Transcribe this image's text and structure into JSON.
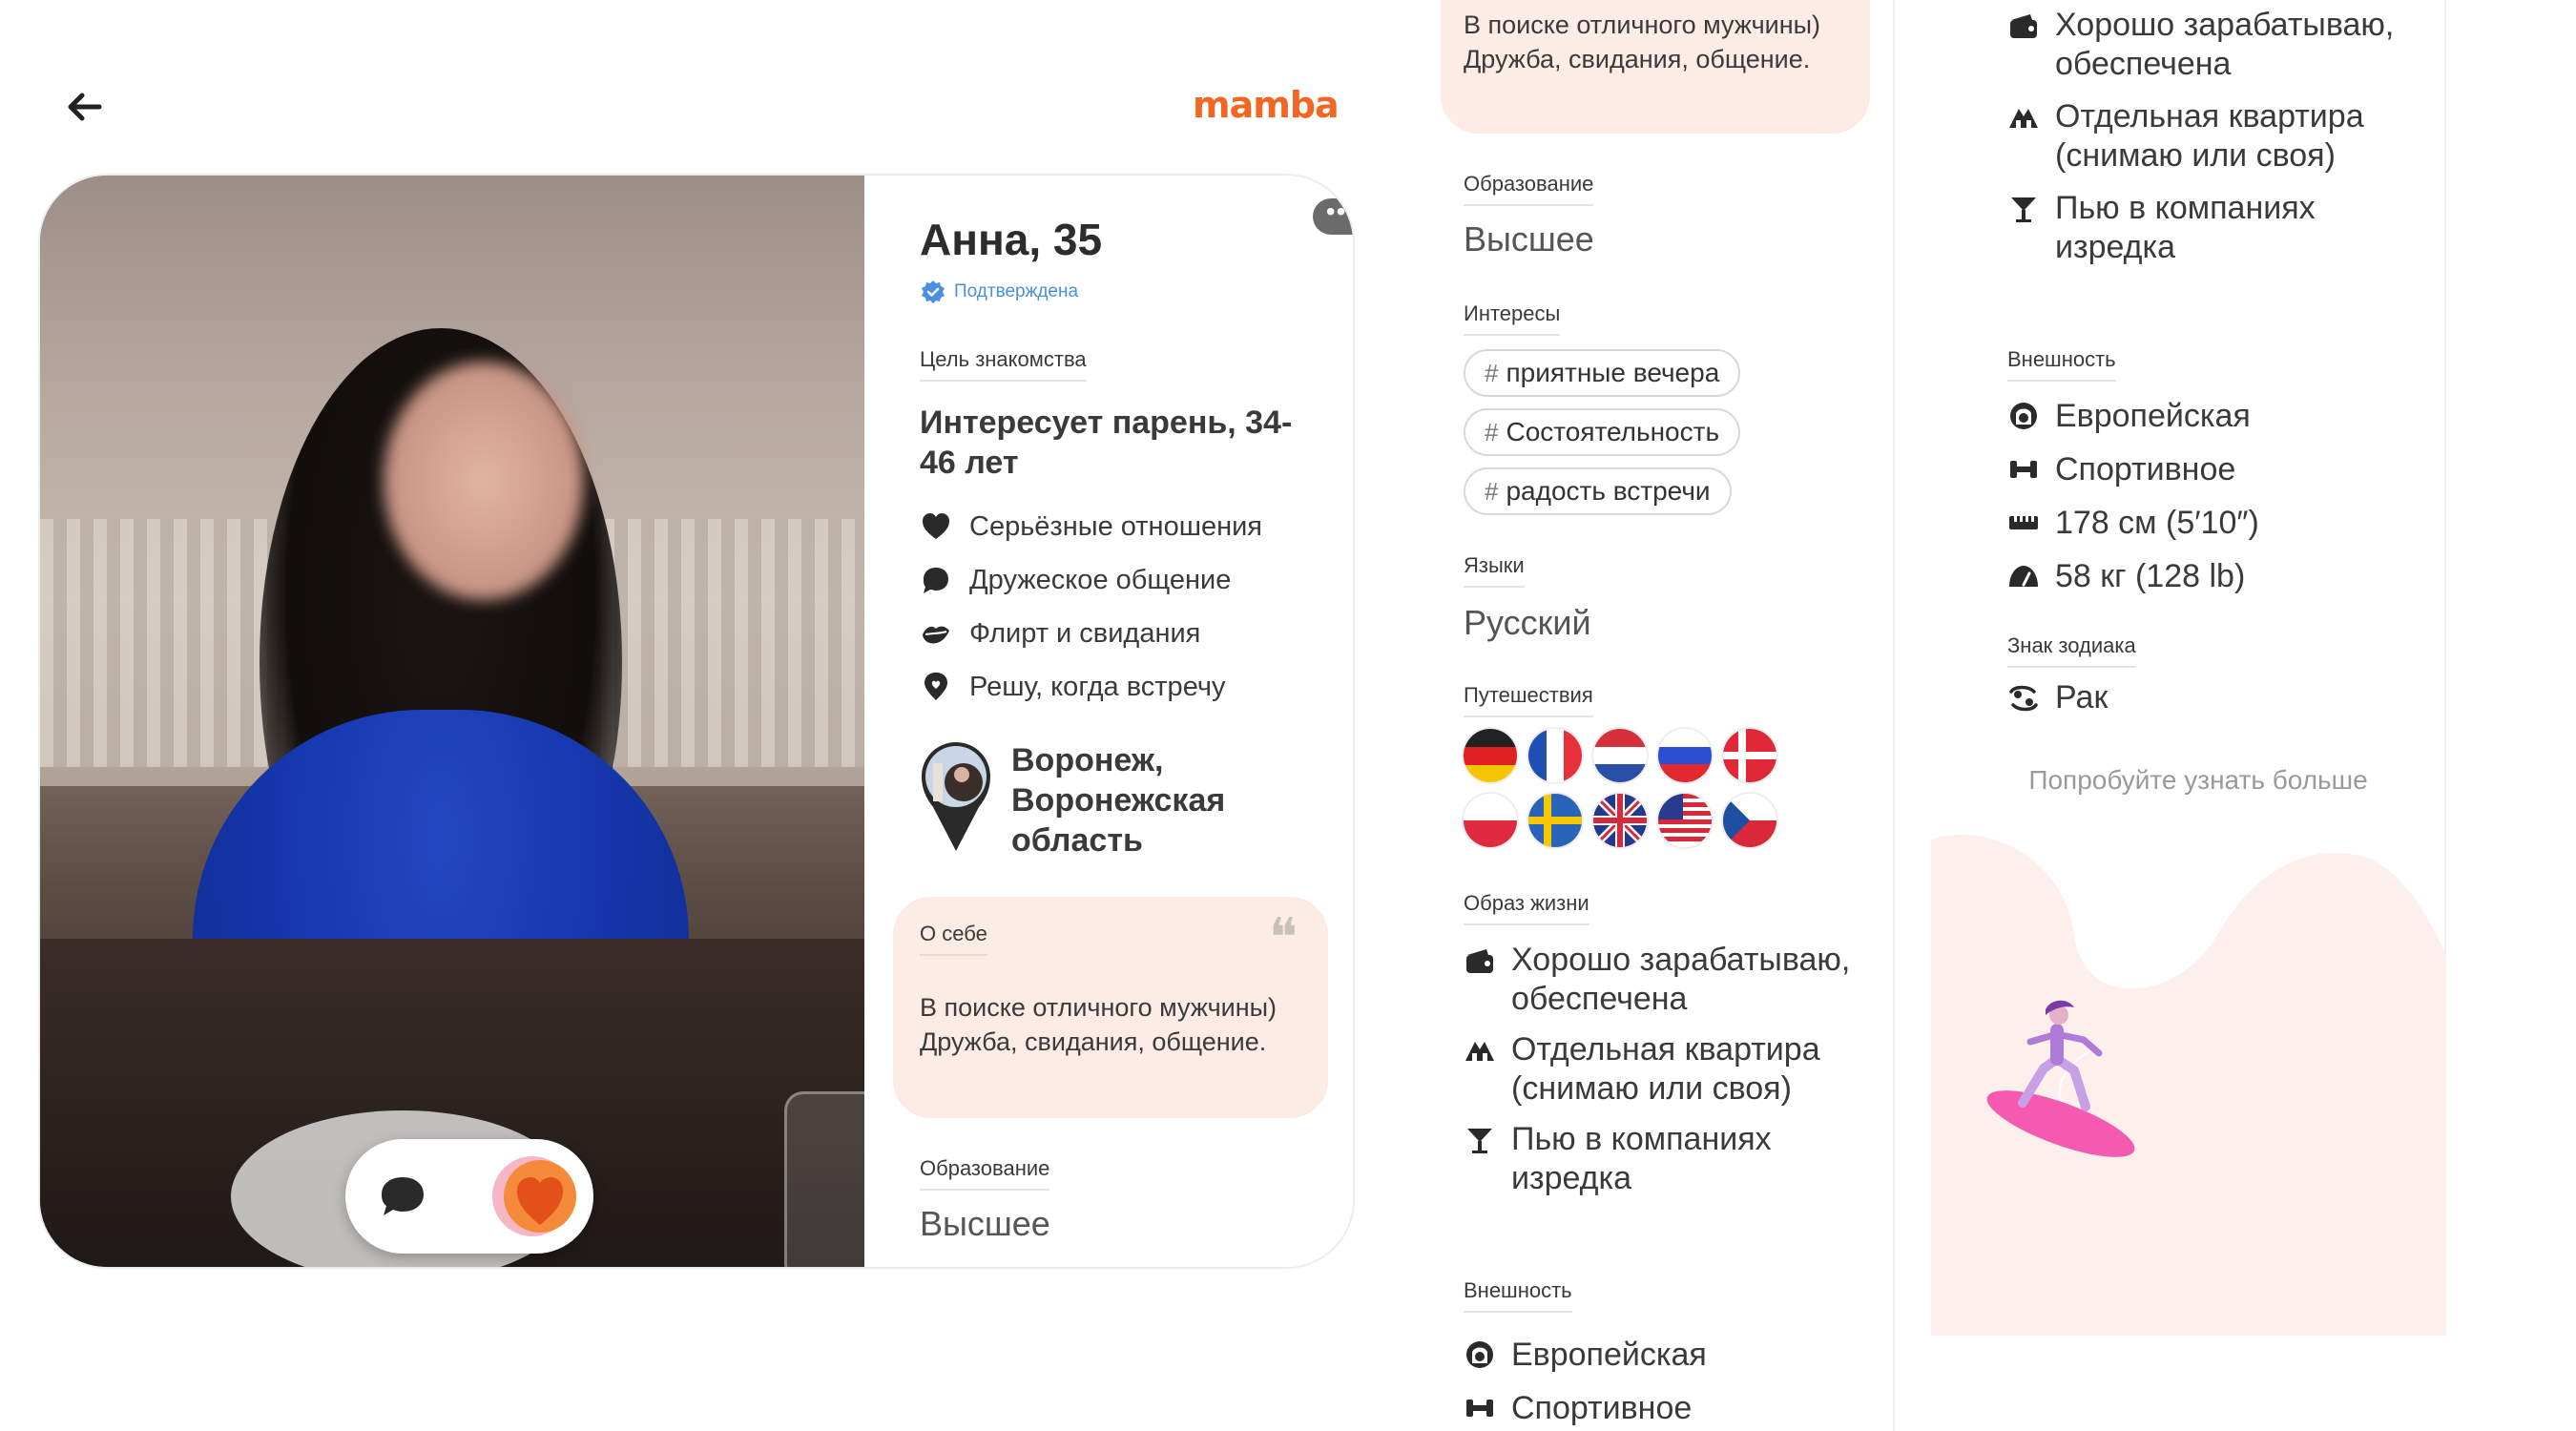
{
  "header": {
    "back_icon": "arrow-left-icon",
    "logo_text": "mamba",
    "brand_color": "#f26522"
  },
  "profile": {
    "name_age": "Анна, 35",
    "verified_label": "Подтверждена",
    "goal_label": "Цель знакомства",
    "goal_value": "Интересует парень, 34-46 лет",
    "goals": [
      {
        "icon": "heart-icon",
        "label": "Серьёзные отношения"
      },
      {
        "icon": "chat-bubble-icon",
        "label": "Дружеское общение"
      },
      {
        "icon": "lips-icon",
        "label": "Флирт и свидания"
      },
      {
        "icon": "location-pin-icon",
        "label": "Решу, когда встречу"
      }
    ],
    "location": "Воронеж, Воронежская область",
    "about_label": "О себе",
    "about_text": "В поиске отличного мужчины) Дружба, свидания, общение.",
    "education_label": "Образование",
    "education_value": "Высшее",
    "more_label": "•••"
  },
  "details": {
    "interests_label": "Интересы",
    "interests": [
      "приятные вечера",
      "Состоятельность",
      "радость встречи"
    ],
    "languages_label": "Языки",
    "languages_value": "Русский",
    "travel_label": "Путешествия",
    "flags": [
      "germany-flag-icon",
      "france-flag-icon",
      "netherlands-flag-icon",
      "russia-flag-icon",
      "denmark-flag-icon",
      "poland-flag-icon",
      "sweden-flag-icon",
      "uk-flag-icon",
      "usa-flag-icon",
      "czech-flag-icon"
    ],
    "lifestyle_label": "Образ жизни",
    "lifestyle": [
      {
        "icon": "wallet-icon",
        "label": "Хорошо зарабатываю, обеспечена"
      },
      {
        "icon": "house-icon",
        "label": "Отдельная квартира (снимаю или своя)"
      },
      {
        "icon": "cocktail-icon",
        "label": "Пью в компаниях изредка"
      }
    ],
    "appearance_label": "Внешность",
    "appearance": [
      {
        "icon": "face-icon",
        "label": "Европейская"
      },
      {
        "icon": "dumbbell-icon",
        "label": "Спортивное"
      },
      {
        "icon": "ruler-icon",
        "label": "178 см (5′10″)"
      },
      {
        "icon": "weight-icon",
        "label": "58 кг (128 lb)"
      }
    ],
    "zodiac_label": "Знак зодиака",
    "zodiac_value": "Рак",
    "try_more": "Попробуйте узнать больше"
  }
}
